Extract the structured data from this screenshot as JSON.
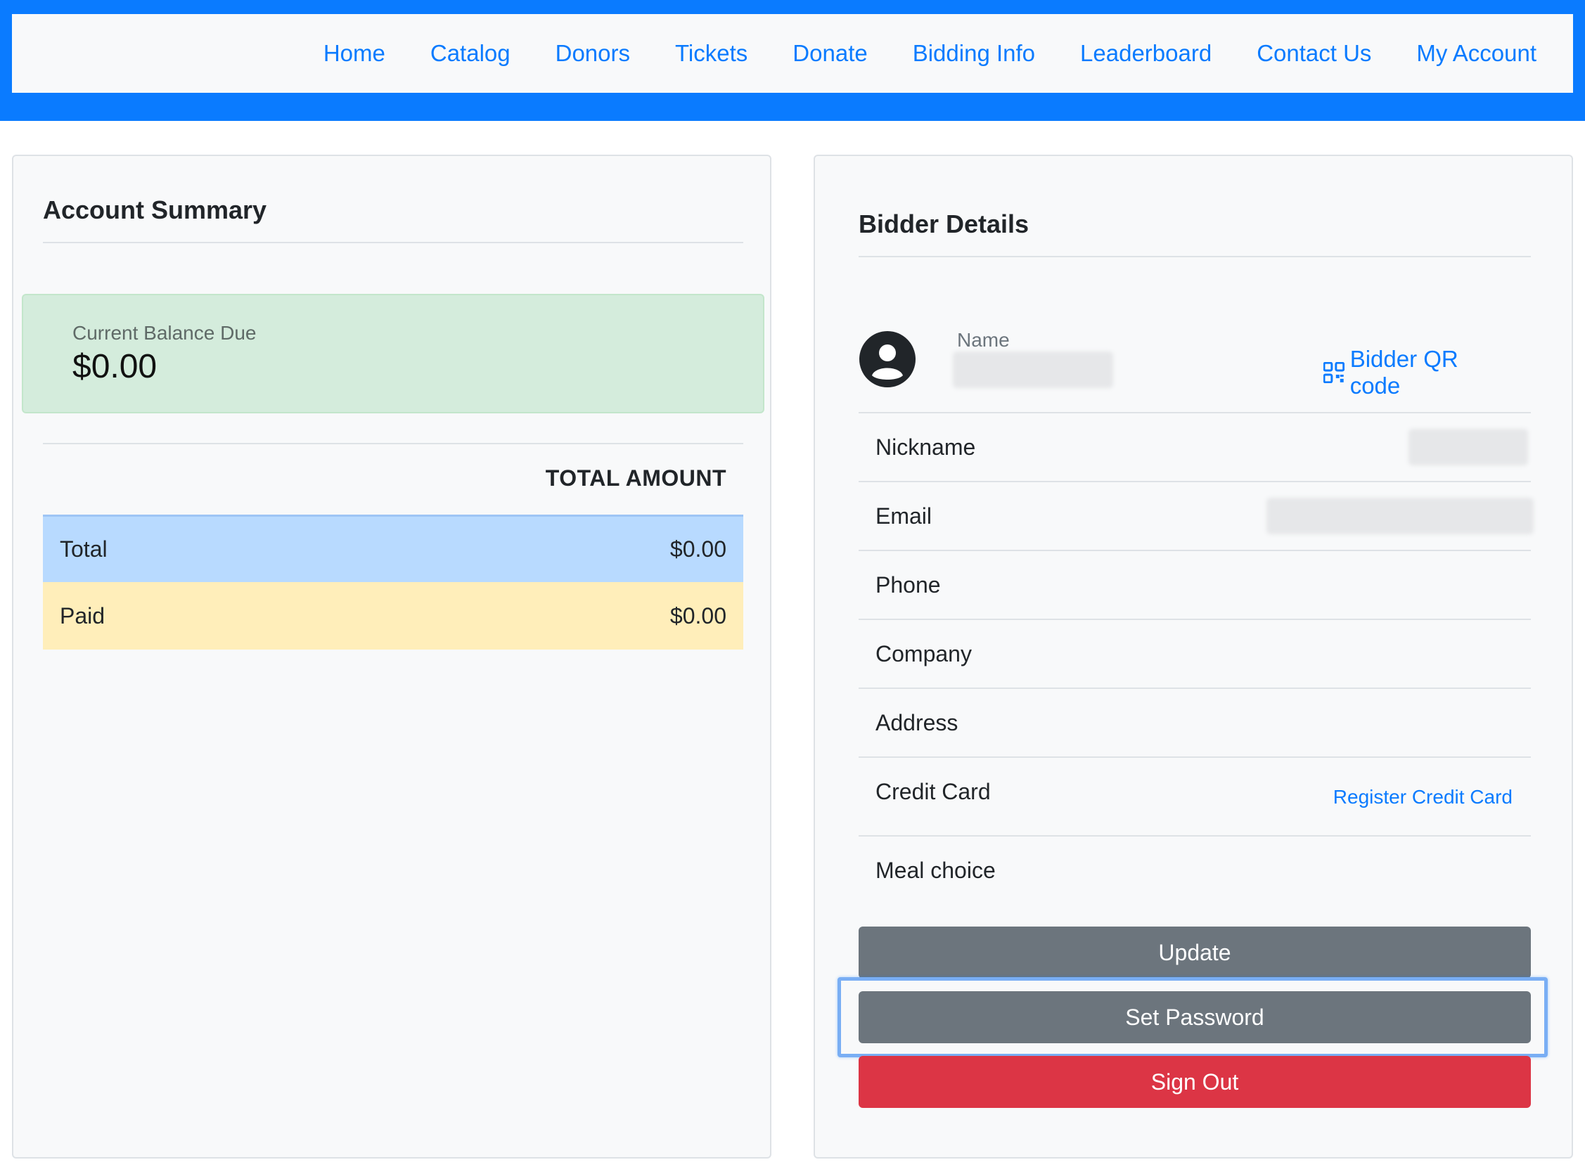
{
  "nav": {
    "items": [
      "Home",
      "Catalog",
      "Donors",
      "Tickets",
      "Donate",
      "Bidding Info",
      "Leaderboard",
      "Contact Us",
      "My Account"
    ]
  },
  "account_summary": {
    "title": "Account Summary",
    "balance_label": "Current Balance Due",
    "balance_value": "$0.00",
    "table_header": "TOTAL AMOUNT",
    "rows": [
      {
        "label": "Total",
        "value": "$0.00"
      },
      {
        "label": "Paid",
        "value": "$0.00"
      }
    ]
  },
  "bidder_details": {
    "title": "Bidder Details",
    "name_label": "Name",
    "qr_link": "Bidder QR code",
    "fields": {
      "nickname": "Nickname",
      "email": "Email",
      "phone": "Phone",
      "company": "Company",
      "address": "Address",
      "credit_card": "Credit Card",
      "meal_choice": "Meal choice"
    },
    "register_credit_card": "Register Credit Card",
    "buttons": {
      "update": "Update",
      "set_password": "Set Password",
      "sign_out": "Sign Out"
    }
  },
  "colors": {
    "brand_blue": "#0a7bff",
    "success_bg": "#d4ecdc",
    "info_row": "#b8daff",
    "warning_row": "#ffeeba",
    "secondary_button": "#6c757d",
    "danger_button": "#dc3545"
  },
  "icons": {
    "avatar": "user-circle-icon",
    "qr": "qr-code-icon"
  }
}
